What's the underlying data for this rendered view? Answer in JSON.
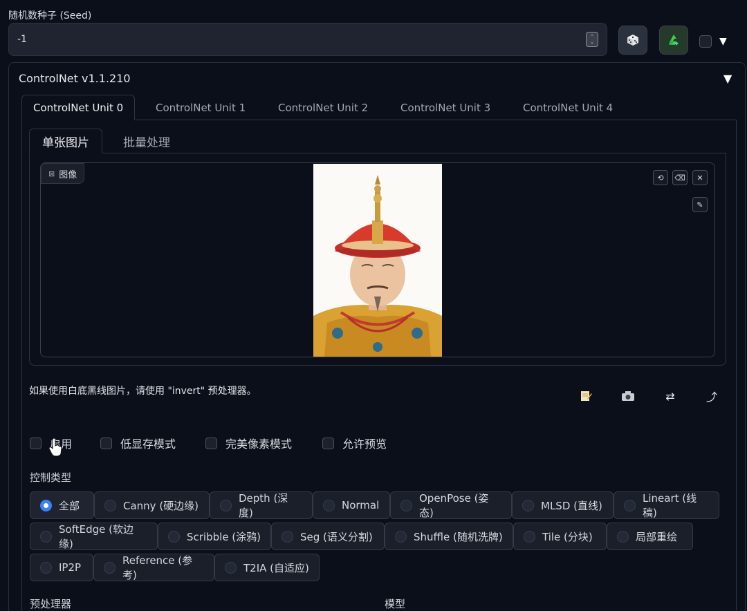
{
  "seed": {
    "label": "随机数种子 (Seed)",
    "value": "-1",
    "spinner_up": "⌃",
    "spinner_down": "⌄"
  },
  "seed_buttons": {
    "dice_icon": "dice-icon",
    "recycle_icon": "recycle-icon",
    "caret": "▼"
  },
  "controlnet": {
    "title": "ControlNet v1.1.210",
    "caret": "▼",
    "units": [
      "ControlNet Unit 0",
      "ControlNet Unit 1",
      "ControlNet Unit 2",
      "ControlNet Unit 3",
      "ControlNet Unit 4"
    ],
    "sub_tabs": [
      "单张图片",
      "批量处理"
    ],
    "image_label": "图像",
    "image_tools": {
      "undo": "⟲",
      "erase": "⌫",
      "close": "✕",
      "brush": "✎"
    },
    "hint": "如果使用白底黑线图片，请使用 \"invert\" 预处理器。",
    "actions": {
      "edit_icon": "edit-icon",
      "camera_icon": "camera-icon",
      "swap": "⇄",
      "send": "⤴"
    },
    "checkboxes": [
      "启用",
      "低显存模式",
      "完美像素模式",
      "允许预览"
    ],
    "control_type_label": "控制类型",
    "control_types": [
      "全部",
      "Canny (硬边缘)",
      "Depth (深度)",
      "Normal",
      "OpenPose (姿态)",
      "MLSD (直线)",
      "Lineart (线稿)",
      "SoftEdge (软边缘)",
      "Scribble (涂鸦)",
      "Seg (语义分割)",
      "Shuffle (随机洗牌)",
      "Tile (分块)",
      "局部重绘",
      "IP2P",
      "Reference (参考)",
      "T2IA (自适应)"
    ],
    "selected_control_type": "全部",
    "preprocessor_label": "预处理器",
    "model_label": "模型"
  },
  "colors": {
    "background": "#0b0f19",
    "accent": "#3b82f6",
    "recycle_green": "#3fcf5a"
  }
}
